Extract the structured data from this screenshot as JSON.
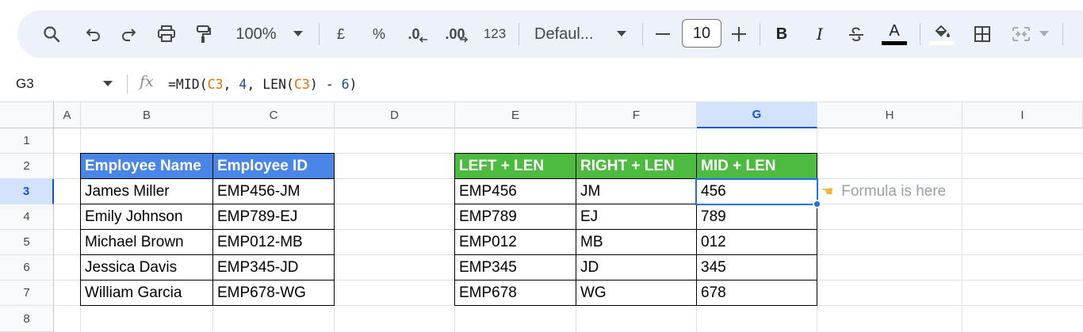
{
  "toolbar": {
    "zoom": "100%",
    "currency": "£",
    "percent": "%",
    "decrease_decimal": ".0",
    "increase_decimal": ".00",
    "number_format": "123",
    "font_family": "Defaul...",
    "font_size": "10",
    "bold": "B",
    "italic": "I",
    "text_color_letter": "A",
    "colors": {
      "text_color": "#000000",
      "fill_color": "#ffffff"
    }
  },
  "formula_bar": {
    "name_box": "G3",
    "fx": "fx",
    "formula": {
      "p1": "=MID(",
      "r1": "C3",
      "p2": ", ",
      "n1": "4",
      "p3": ", LEN(",
      "r2": "C3",
      "p4": ") - ",
      "n2": "6",
      "p5": ")"
    }
  },
  "grid": {
    "columns": [
      "A",
      "B",
      "C",
      "D",
      "E",
      "F",
      "G",
      "H",
      "I"
    ],
    "rows": [
      "1",
      "2",
      "3",
      "4",
      "5",
      "6",
      "7",
      "8"
    ],
    "selected_cell": "G3"
  },
  "table1": {
    "headers": [
      "Employee Name",
      "Employee ID"
    ],
    "rows": [
      [
        "James Miller",
        "EMP456-JM"
      ],
      [
        "Emily Johnson",
        "EMP789-EJ"
      ],
      [
        "Michael Brown",
        "EMP012-MB"
      ],
      [
        "Jessica Davis",
        "EMP345-JD"
      ],
      [
        "William Garcia",
        "EMP678-WG"
      ]
    ],
    "header_color": "#4a86e8"
  },
  "table2": {
    "headers": [
      "LEFT + LEN",
      "RIGHT + LEN",
      "MID + LEN"
    ],
    "rows": [
      [
        "EMP456",
        "JM",
        "456"
      ],
      [
        "EMP789",
        "EJ",
        "789"
      ],
      [
        "EMP012",
        "MB",
        "012"
      ],
      [
        "EMP345",
        "JD",
        "345"
      ],
      [
        "EMP678",
        "WG",
        "678"
      ]
    ],
    "header_color": "#4cbb3f"
  },
  "note": {
    "icon": "pointing-hand-icon",
    "text": "Formula is here"
  }
}
